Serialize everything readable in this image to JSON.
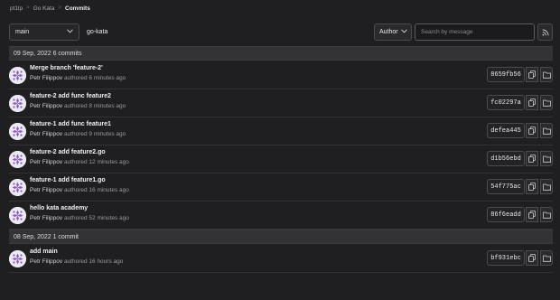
{
  "breadcrumb": {
    "items": [
      "pt1lp",
      "Go Kata",
      "Commits"
    ]
  },
  "toolbar": {
    "branch": "main",
    "path": "go-kata",
    "author_label": "Author",
    "search_placeholder": "Search by message"
  },
  "groups": [
    {
      "header": "09 Sep, 2022 6 commits",
      "commits": [
        {
          "title": "Merge branch 'feature-2'",
          "author": "Petr Filippov",
          "time": "authored 6 minutes ago",
          "sha": "8659fb56"
        },
        {
          "title": "feature-2 add func feature2",
          "author": "Petr Filippov",
          "time": "authored 8 minutes ago",
          "sha": "fc02297a"
        },
        {
          "title": "feature-1 add func feature1",
          "author": "Petr Filippov",
          "time": "authored 9 minutes ago",
          "sha": "defea445"
        },
        {
          "title": "feature-2 add feature2.go",
          "author": "Petr Filippov",
          "time": "authored 12 minutes ago",
          "sha": "d1b56ebd"
        },
        {
          "title": "feature-1 add feature1.go",
          "author": "Petr Filippov",
          "time": "authored 16 minutes ago",
          "sha": "54f775ac"
        },
        {
          "title": "hello kata academy",
          "author": "Petr Filippov",
          "time": "authored 52 minutes ago",
          "sha": "86f6eadd"
        }
      ]
    },
    {
      "header": "08 Sep, 2022 1 commit",
      "commits": [
        {
          "title": "add main",
          "author": "Petr Filippov",
          "time": "authored 16 hours ago",
          "sha": "bf931ebc"
        }
      ]
    }
  ],
  "icons": {
    "branch_chevron": "chevron-down-icon",
    "author_chevron": "chevron-down-icon",
    "rss": "rss-icon",
    "copy": "copy-icon",
    "browse": "folder-icon",
    "avatar": "identicon-avatar"
  },
  "colors": {
    "background": "#1f1f21",
    "header_band": "#333336",
    "border": "#4a4a4f",
    "avatar_pattern": "#8b5fbf"
  }
}
